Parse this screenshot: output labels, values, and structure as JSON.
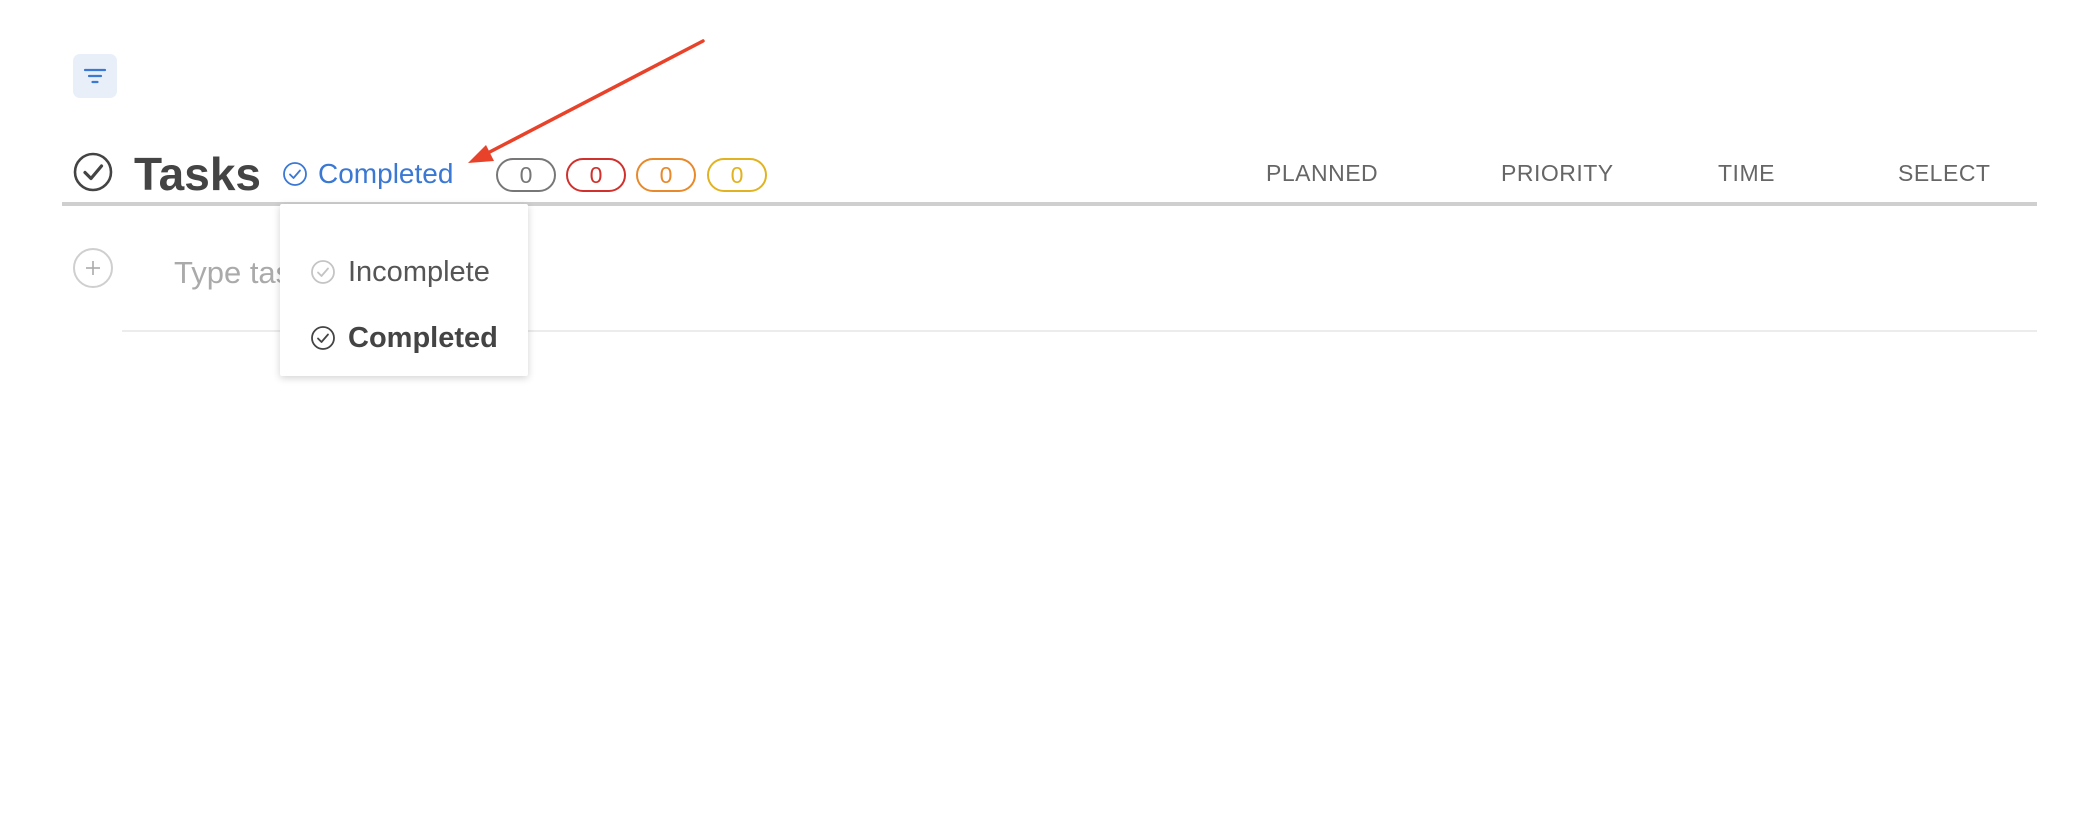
{
  "toolbar": {
    "filter_icon": "filter-icon"
  },
  "header": {
    "title": "Tasks",
    "title_icon": "check-circle-icon",
    "status_filter": {
      "label": "Completed",
      "icon": "check-circle-icon",
      "color": "#3a78d4"
    },
    "counters": [
      {
        "value": "0",
        "color": "#777777"
      },
      {
        "value": "0",
        "color": "#d0312d"
      },
      {
        "value": "0",
        "color": "#e8892b"
      },
      {
        "value": "0",
        "color": "#e2b320"
      }
    ],
    "columns": [
      "PLANNED",
      "PRIORITY",
      "TIME",
      "SELECT"
    ]
  },
  "add_task": {
    "placeholder": "Type task",
    "icon": "plus-icon"
  },
  "dropdown": {
    "items": [
      {
        "label": "Incomplete",
        "icon": "check-circle-icon",
        "selected": false
      },
      {
        "label": "Completed",
        "icon": "check-circle-icon",
        "selected": true
      }
    ]
  },
  "annotation": {
    "arrow_color": "#e8432a"
  }
}
